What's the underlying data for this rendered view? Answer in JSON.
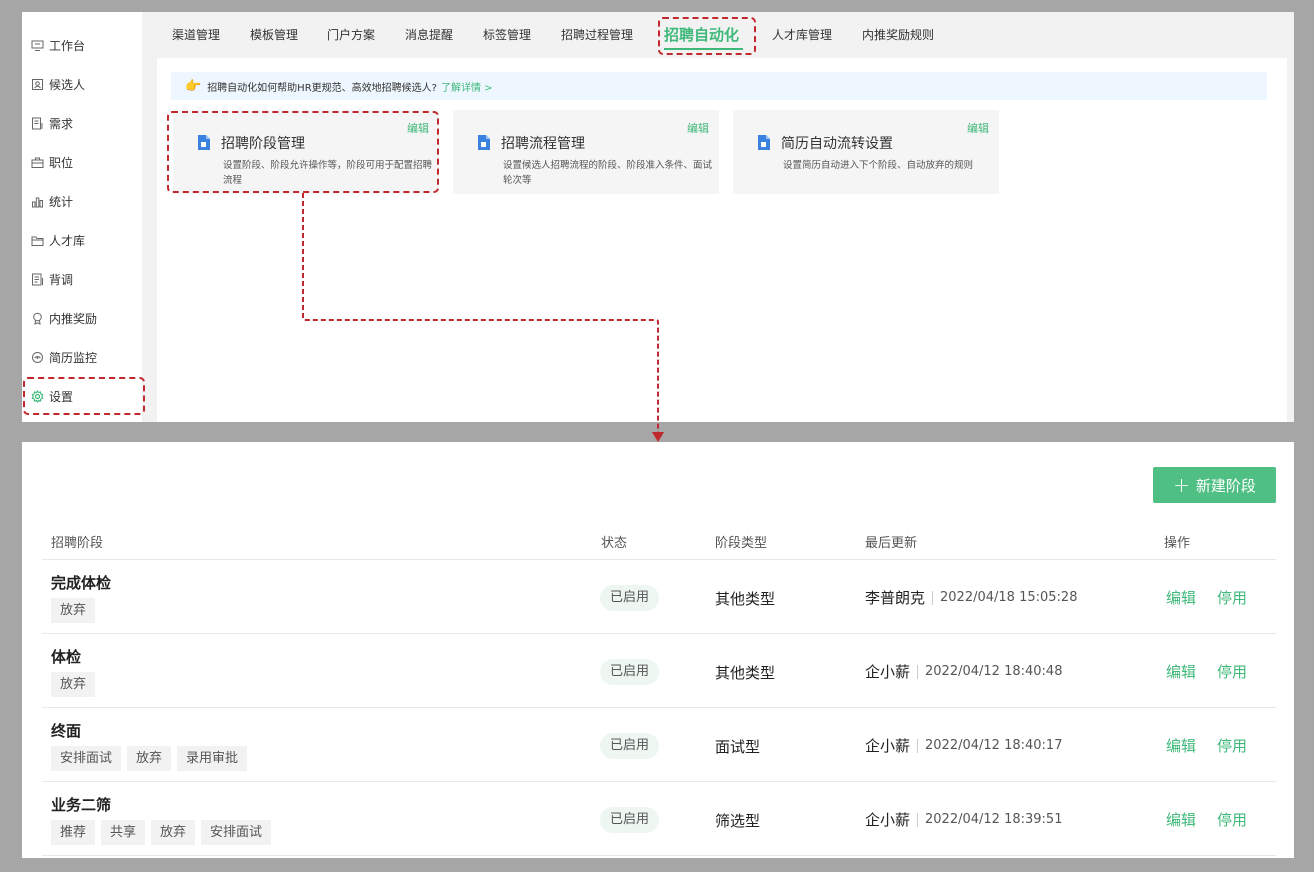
{
  "sidebar": {
    "items": [
      {
        "label": "工作台",
        "icon": "monitor-icon"
      },
      {
        "label": "候选人",
        "icon": "contact-icon"
      },
      {
        "label": "需求",
        "icon": "document-edit-icon"
      },
      {
        "label": "职位",
        "icon": "briefcase-icon"
      },
      {
        "label": "统计",
        "icon": "bar-chart-icon"
      },
      {
        "label": "人才库",
        "icon": "folder-icon"
      },
      {
        "label": "背调",
        "icon": "report-icon"
      },
      {
        "label": "内推奖励",
        "icon": "medal-icon"
      },
      {
        "label": "简历监控",
        "icon": "monitor-eye-icon"
      },
      {
        "label": "设置",
        "icon": "gear-icon"
      }
    ]
  },
  "tabs": [
    "渠道管理",
    "模板管理",
    "门户方案",
    "消息提醒",
    "标签管理",
    "招聘过程管理",
    "招聘自动化",
    "人才库管理",
    "内推奖励规则"
  ],
  "tip": {
    "text": "招聘自动化如何帮助HR更规范、高效地招聘候选人?",
    "link": "了解详情 >"
  },
  "features": [
    {
      "title": "招聘阶段管理",
      "edit": "编辑",
      "desc": "设置阶段、阶段允许操作等，阶段可用于配置招聘流程"
    },
    {
      "title": "招聘流程管理",
      "edit": "编辑",
      "desc": "设置候选人招聘流程的阶段、阶段准入条件、面试轮次等"
    },
    {
      "title": "简历自动流转设置",
      "edit": "编辑",
      "desc": "设置简历自动进入下个阶段、自动放弃的规则"
    }
  ],
  "stages": {
    "new_button": "新建阶段",
    "headers": {
      "stage": "招聘阶段",
      "status": "状态",
      "type": "阶段类型",
      "updated": "最后更新",
      "actions": "操作"
    },
    "rows": [
      {
        "name": "完成体检",
        "tags": [
          "放弃"
        ],
        "status": "已启用",
        "type": "其他类型",
        "user": "李普朗克",
        "time": "2022/04/18 15:05:28",
        "edit": "编辑",
        "disable": "停用"
      },
      {
        "name": "体检",
        "tags": [
          "放弃"
        ],
        "status": "已启用",
        "type": "其他类型",
        "user": "企小薪",
        "time": "2022/04/12 18:40:48",
        "edit": "编辑",
        "disable": "停用"
      },
      {
        "name": "终面",
        "tags": [
          "安排面试",
          "放弃",
          "录用审批"
        ],
        "status": "已启用",
        "type": "面试型",
        "user": "企小薪",
        "time": "2022/04/12 18:40:17",
        "edit": "编辑",
        "disable": "停用"
      },
      {
        "name": "业务二筛",
        "tags": [
          "推荐",
          "共享",
          "放弃",
          "安排面试"
        ],
        "status": "已启用",
        "type": "筛选型",
        "user": "企小薪",
        "time": "2022/04/12 18:39:51",
        "edit": "编辑",
        "disable": "停用"
      }
    ]
  },
  "colors": {
    "accent": "#3fb97a",
    "highlight": "#c0282d",
    "button": "#4fbf84"
  }
}
